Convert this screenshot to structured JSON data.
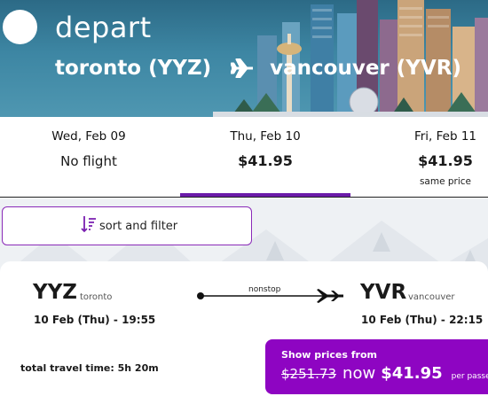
{
  "header": {
    "title": "depart",
    "origin": "toronto (YYZ)",
    "destination": "vancouver (YVR)"
  },
  "dates": [
    {
      "date": "Wed, Feb 09",
      "status": "No flight"
    },
    {
      "date": "Thu, Feb 10",
      "price": "$41.95",
      "selected": true
    },
    {
      "date": "Fri, Feb 11",
      "price": "$41.95",
      "note": "same price"
    }
  ],
  "sort_filter": {
    "label": "sort and filter"
  },
  "flight": {
    "from_code": "YYZ",
    "from_city": "toronto",
    "from_datetime": "10 Feb (Thu) - 19:55",
    "stops": "nonstop",
    "to_code": "YVR",
    "to_city": "vancouver",
    "to_datetime": "10 Feb (Thu) - 22:15",
    "total_travel_time": "total travel time: 5h 20m",
    "price_button": {
      "heading": "Show prices from",
      "old_price": "$251.73",
      "now_label": "now",
      "new_price": "$41.95",
      "per": "per passenger"
    }
  },
  "colors": {
    "accent": "#8e05c2",
    "selected_underline": "#6b1ba9",
    "header_sky": "#3d86a3"
  },
  "icons": [
    "back-circle-icon",
    "airplane-icon",
    "sort-icon",
    "arrow-right-icon"
  ]
}
